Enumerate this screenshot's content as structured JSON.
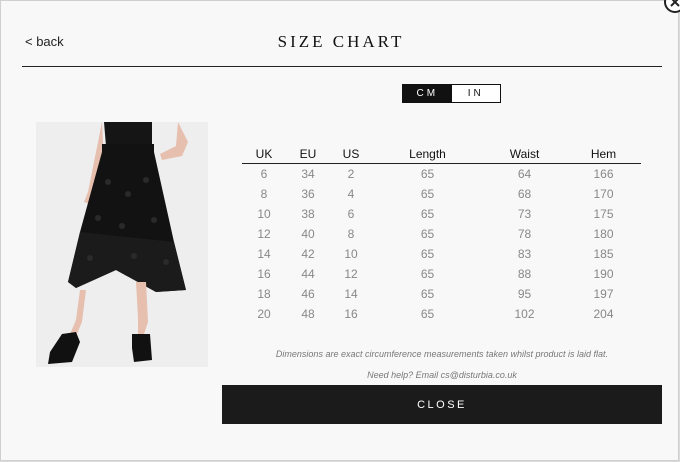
{
  "nav": {
    "back_label": "< back"
  },
  "title": "SIZE CHART",
  "units": {
    "options": [
      "CM",
      "IN"
    ],
    "selected": "CM"
  },
  "table": {
    "headers": [
      "UK",
      "EU",
      "US",
      "Length",
      "Waist",
      "Hem"
    ],
    "rows": [
      [
        "6",
        "34",
        "2",
        "65",
        "64",
        "166"
      ],
      [
        "8",
        "36",
        "4",
        "65",
        "68",
        "170"
      ],
      [
        "10",
        "38",
        "6",
        "65",
        "73",
        "175"
      ],
      [
        "12",
        "40",
        "8",
        "65",
        "78",
        "180"
      ],
      [
        "14",
        "42",
        "10",
        "65",
        "83",
        "185"
      ],
      [
        "16",
        "44",
        "12",
        "65",
        "88",
        "190"
      ],
      [
        "18",
        "46",
        "14",
        "65",
        "95",
        "197"
      ],
      [
        "20",
        "48",
        "16",
        "65",
        "102",
        "204"
      ]
    ]
  },
  "note": "Dimensions are exact circumference measurements taken whilst product is laid flat.",
  "help": "Need help? Email cs@disturbia.co.uk",
  "close_label": "CLOSE",
  "icons": {
    "dismiss": "close-x-icon"
  },
  "colors": {
    "accent": "#1b1b1b",
    "text_muted": "#888888"
  }
}
